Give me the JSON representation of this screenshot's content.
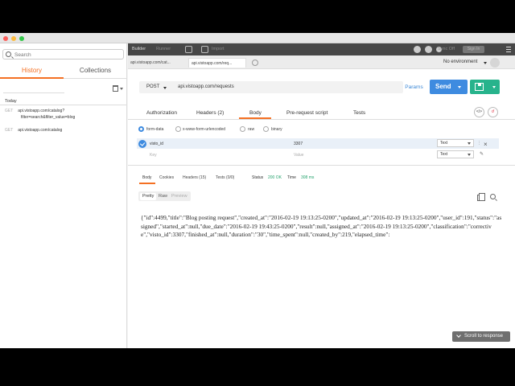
{
  "sidebar": {
    "search_placeholder": "Search",
    "tabs": {
      "history": "History",
      "collections": "Collections"
    },
    "group": "Today",
    "history": [
      {
        "method": "GET",
        "line1": "api.vistoapp.com/catalog?",
        "line2": "filter=search&filter_value=blog"
      },
      {
        "method": "GET",
        "line1": "api.vistoapp.com/catalog",
        "line2": ""
      }
    ]
  },
  "topbar": {
    "builder": "Builder",
    "runner": "Runner",
    "import": "Import",
    "sync": "Sync Off",
    "sign_in": "Sign In"
  },
  "request_tabs": [
    "api.vistoapp.com/cat...",
    "api.vistoapp.com/req..."
  ],
  "environment": "No environment",
  "request": {
    "method": "POST",
    "url": "api.vistoapp.com/requests",
    "params": "Params",
    "send": "Send"
  },
  "request_subtabs": [
    "Authorization",
    "Headers (2)",
    "Body",
    "Pre-request script",
    "Tests"
  ],
  "body_modes": [
    "form-data",
    "x-www-form-urlencoded",
    "raw",
    "binary"
  ],
  "form_rows": [
    {
      "key": "visto_id",
      "value": "3307",
      "type": "Text"
    },
    {
      "key": "Key",
      "value": "Value",
      "type": "Text"
    }
  ],
  "response": {
    "tabs": [
      "Body",
      "Cookies",
      "Headers (15)",
      "Tests (0/0)"
    ],
    "status_label": "Status",
    "status_value": "200 OK",
    "time_label": "Time",
    "time_value": "308 ms",
    "views": [
      "Pretty",
      "Raw",
      "Preview"
    ],
    "body": "{\"id\":4499,\"title\":\"Blog posting request\",\"created_at\":\"2016-02-19 19:13:25-0200\",\"updated_at\":\"2016-02-19 19:13:25-0200\",\"user_id\":191,\"status\":\"assigned\",\"started_at\":null,\"due_date\":\"2016-02-19 19:43:25-0200\",\"result\":null,\"assigned_at\":\"2016-02-19 19:13:25-0200\",\"classification\":\"corrective\",\"visto_id\":3307,\"finished_at\":null,\"duration\":\"30\",\"time_spent\":null,\"created_by\":219,\"elapsed_time\":"
  },
  "scroll_to_response": "Scroll to response",
  "colors": {
    "accent": "#f47023",
    "primary": "#3e8be0",
    "save": "#27b38c",
    "topbar": "#474747"
  }
}
